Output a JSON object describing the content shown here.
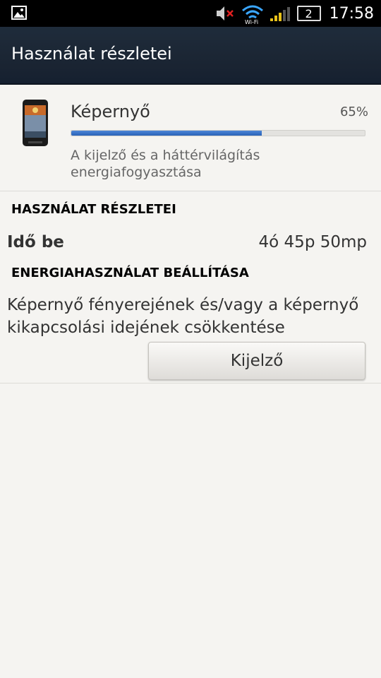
{
  "status_bar": {
    "time": "17:58",
    "battery_level": "2",
    "icons": [
      "image-notification-icon",
      "mute-icon",
      "wifi-icon",
      "signal-icon",
      "battery-icon"
    ]
  },
  "action_bar": {
    "title": "Használat részletei"
  },
  "app": {
    "name": "Képernyő",
    "percent": "65%",
    "progress": 0.65,
    "description": "A kijelző és a háttérvilágítás energiafogyasztása",
    "icon": "phone-icon"
  },
  "details": {
    "header": "HASZNÁLAT RÉSZLETEI",
    "time_label": "Idő be",
    "time_value": "4ó 45p 50mp"
  },
  "energy": {
    "header": "ENERGIAHASZNÁLAT BEÁLLÍTÁSA",
    "hint": "Képernyő fényerejének és/vagy a képernyő kikapcsolási idejének csökkentése",
    "button_label": "Kijelző"
  },
  "colors": {
    "accent": "#2a63b8",
    "action_bar": "#1f2c3b",
    "background": "#f5f4f1"
  }
}
